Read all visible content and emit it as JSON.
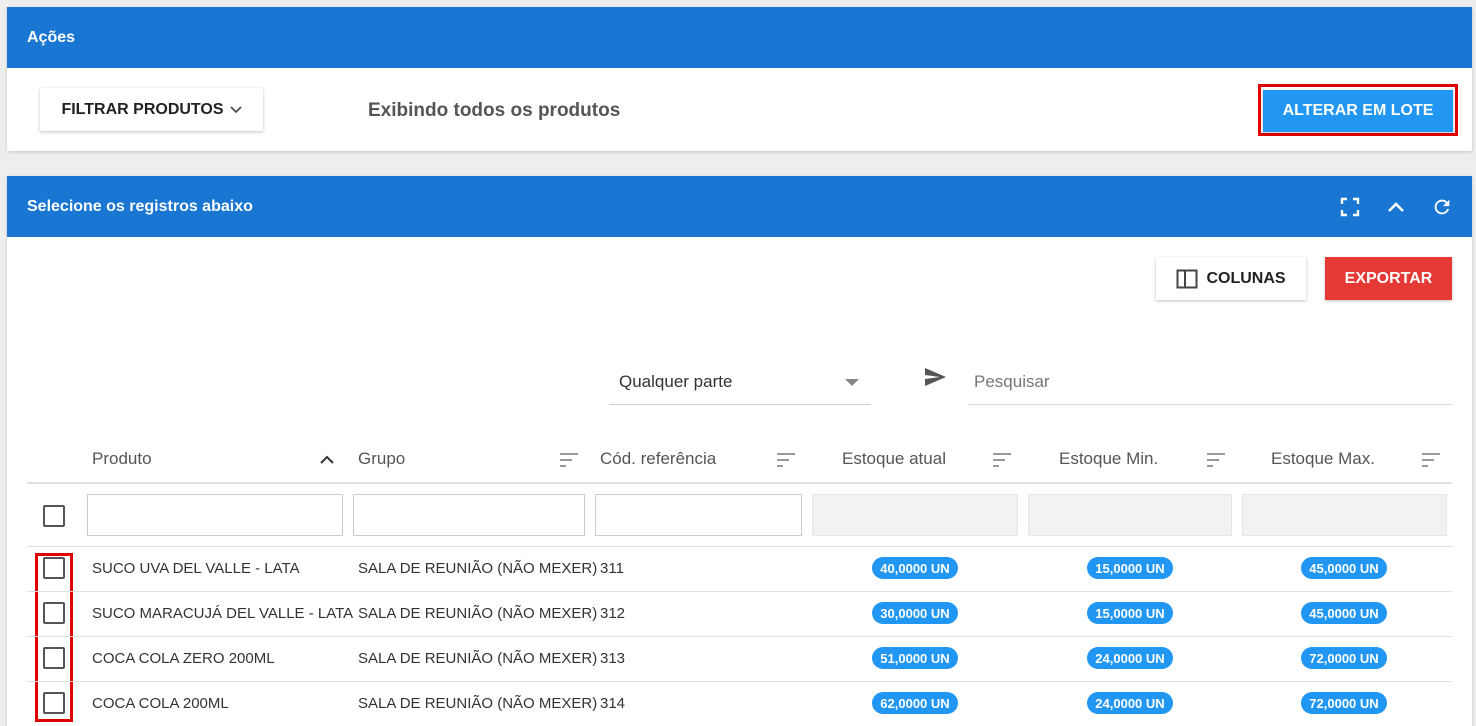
{
  "acoes": {
    "title": "Ações",
    "filtrar_label": "FILTRAR PRODUTOS",
    "status_text": "Exibindo todos os produtos",
    "alterar_label": "ALTERAR EM LOTE"
  },
  "registros": {
    "title": "Selecione os registros abaixo",
    "colunas_label": "COLUNAS",
    "exportar_label": "EXPORTAR",
    "search_mode": "Qualquer parte",
    "search_placeholder": "Pesquisar",
    "columns": [
      "Produto",
      "Grupo",
      "Cód. referência",
      "Estoque atual",
      "Estoque Min.",
      "Estoque Max."
    ],
    "rows": [
      {
        "produto": "SUCO UVA DEL VALLE - LATA",
        "grupo": "SALA DE REUNIÃO (NÃO MEXER)",
        "cod": "311",
        "atual": "40,0000 UN",
        "min": "15,0000 UN",
        "max": "45,0000 UN"
      },
      {
        "produto": "SUCO MARACUJÁ DEL VALLE - LATA",
        "grupo": "SALA DE REUNIÃO (NÃO MEXER)",
        "cod": "312",
        "atual": "30,0000 UN",
        "min": "15,0000 UN",
        "max": "45,0000 UN"
      },
      {
        "produto": "COCA COLA ZERO 200ML",
        "grupo": "SALA DE REUNIÃO (NÃO MEXER)",
        "cod": "313",
        "atual": "51,0000 UN",
        "min": "24,0000 UN",
        "max": "72,0000 UN"
      },
      {
        "produto": "COCA COLA 200ML",
        "grupo": "SALA DE REUNIÃO (NÃO MEXER)",
        "cod": "314",
        "atual": "62,0000 UN",
        "min": "24,0000 UN",
        "max": "72,0000 UN"
      }
    ]
  },
  "colors": {
    "header_blue": "#1976d2",
    "primary_blue": "#2196f3",
    "danger_red": "#e53935",
    "highlight_red": "#e10000"
  }
}
